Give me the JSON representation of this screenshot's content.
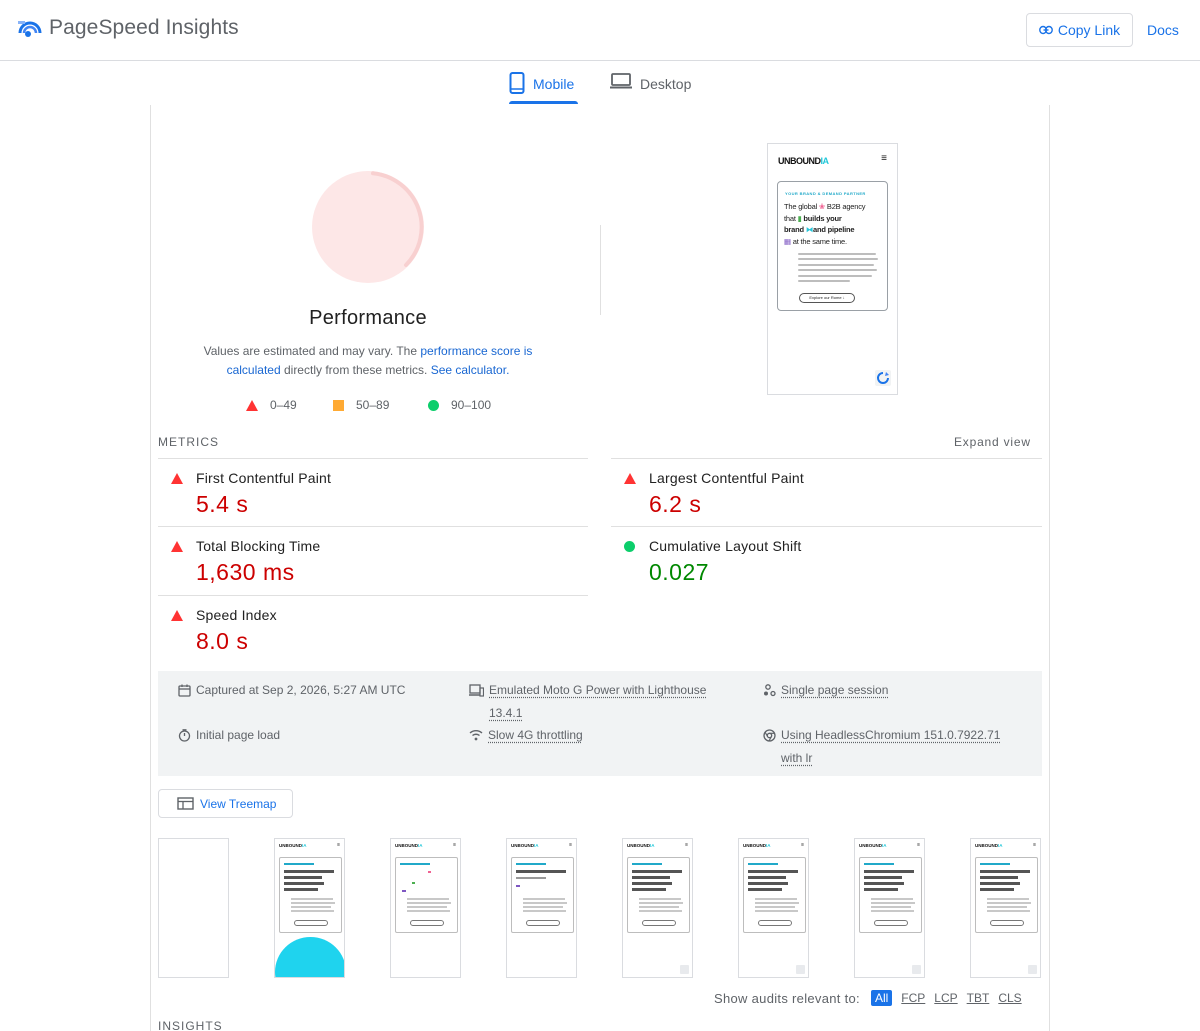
{
  "header": {
    "brand_name": "PageSpeed Insights",
    "copy_link_label": "Copy Link",
    "docs_label": "Docs",
    "accent_color": "#1a73e8"
  },
  "tabs": [
    {
      "label": "Mobile",
      "active": true,
      "icon": "smartphone-icon"
    },
    {
      "label": "Desktop",
      "active": false,
      "icon": "laptop-icon"
    }
  ],
  "performance": {
    "title": "Performance",
    "desc_prefix": "Values are estimated and may vary. The ",
    "desc_link1": "performance score is calculated",
    "desc_mid": " directly from these metrics. ",
    "desc_link2": "See calculator.",
    "legend": [
      {
        "range": "0–49",
        "shape": "triangle",
        "color": "#ff3333"
      },
      {
        "range": "50–89",
        "shape": "square",
        "color": "#ffaa33"
      },
      {
        "range": "90–100",
        "shape": "circle",
        "color": "#0cce6b"
      }
    ]
  },
  "screenshot": {
    "logo_main": "UNBOUND",
    "logo_accent": "IA",
    "eyebrow": "YOUR BRAND & DEMAND PARTNER",
    "headline_1": "The global ",
    "headline_2": " B2B agency",
    "headline_3": "that ",
    "headline_4": "builds your",
    "headline_5": "brand ",
    "headline_6": "and pipeline",
    "headline_7": " at the same time.",
    "cta": "Explore our Rome ↓"
  },
  "metrics": {
    "header": "METRICS",
    "expand_label": "Expand view",
    "fcp": {
      "name": "First Contentful Paint",
      "value": "5.4 s",
      "status": "bad"
    },
    "lcp": {
      "name": "Largest Contentful Paint",
      "value": "6.2 s",
      "status": "bad"
    },
    "tbt": {
      "name": "Total Blocking Time",
      "value": "1,630 ms",
      "status": "bad"
    },
    "cls": {
      "name": "Cumulative Layout Shift",
      "value": "0.027",
      "status": "good"
    },
    "si": {
      "name": "Speed Index",
      "value": "8.0 s",
      "status": "bad"
    }
  },
  "environment": {
    "captured": "Captured at Sep 2, 2026, 5:27 AM UTC",
    "device_1": "Emulated Moto G Power with Lighthouse",
    "device_2": "13.4.1",
    "session": "Single page session",
    "load": "Initial page load",
    "throttling": "Slow 4G throttling",
    "browser_1": "Using HeadlessChromium 151.0.7922.71",
    "browser_2": "with lr"
  },
  "treemap_label": "View Treemap",
  "filmstrip": {
    "frame_count": 8,
    "frame2_text_1": "We're here to",
    "frame2_text_2": "Two equal in.",
    "frame2_text_3": "One driving force."
  },
  "audit_filter": {
    "label": "Show audits relevant to:",
    "options": [
      "All",
      "FCP",
      "LCP",
      "TBT",
      "CLS"
    ],
    "active": "All"
  },
  "insights_header": "INSIGHTS"
}
